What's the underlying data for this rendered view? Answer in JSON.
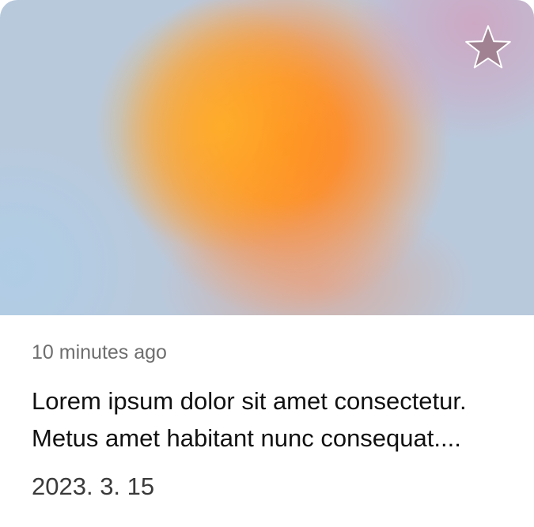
{
  "card": {
    "favorite_icon": "star-icon",
    "relative_time": "10 minutes ago",
    "title_lines": [
      "Lorem ipsum dolor sit amet consectetur.",
      "Metus amet habitant nunc consequat...."
    ],
    "date": "2023. 3. 15",
    "colors": {
      "gradient_primary": "#ff7f22",
      "gradient_secondary": "#f6b23a",
      "gradient_edge_blue": "#b3cbe0",
      "gradient_edge_pink": "#d4a2c0",
      "star_fill": "#a08292",
      "time_text": "#6e6e6e",
      "title_text": "#111111",
      "date_text": "#3a3a3a"
    }
  }
}
